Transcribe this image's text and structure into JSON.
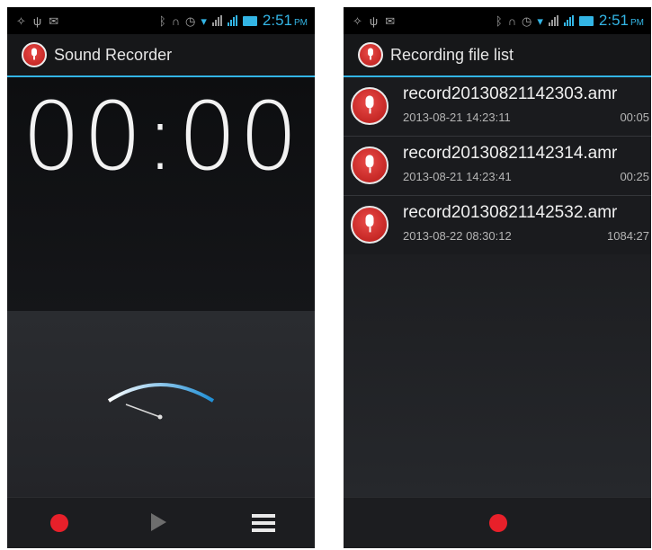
{
  "left_screen": {
    "status_bar": {
      "time": "2:51",
      "ampm": "PM",
      "icons": [
        "gps-icon",
        "usb-icon",
        "mail-icon",
        "bluetooth-icon",
        "headset-icon",
        "alarm-icon",
        "wifi-icon",
        "signal-icon",
        "signal-icon",
        "battery-icon"
      ]
    },
    "title": "Sound Recorder",
    "timer": "00:00",
    "buttons": {
      "record": "record-icon",
      "play": "play-icon",
      "list": "list-icon"
    }
  },
  "right_screen": {
    "status_bar": {
      "time": "2:51",
      "ampm": "PM",
      "icons": [
        "gps-icon",
        "usb-icon",
        "mail-icon",
        "bluetooth-icon",
        "headset-icon",
        "alarm-icon",
        "wifi-icon",
        "signal-icon",
        "signal-icon",
        "battery-icon"
      ]
    },
    "title": "Recording file list",
    "files": [
      {
        "name": "record20130821142303.amr",
        "date": "2013-08-21 14:23:11",
        "duration": "00:05"
      },
      {
        "name": "record20130821142314.amr",
        "date": "2013-08-21 14:23:41",
        "duration": "00:25"
      },
      {
        "name": "record20130821142532.amr",
        "date": "2013-08-22 08:30:12",
        "duration": "1084:27"
      }
    ],
    "buttons": {
      "record": "record-icon"
    }
  },
  "colors": {
    "accent": "#33b5e5",
    "record_red": "#e8202a",
    "background": "#1a1b1e",
    "text": "#f2f2f2"
  }
}
